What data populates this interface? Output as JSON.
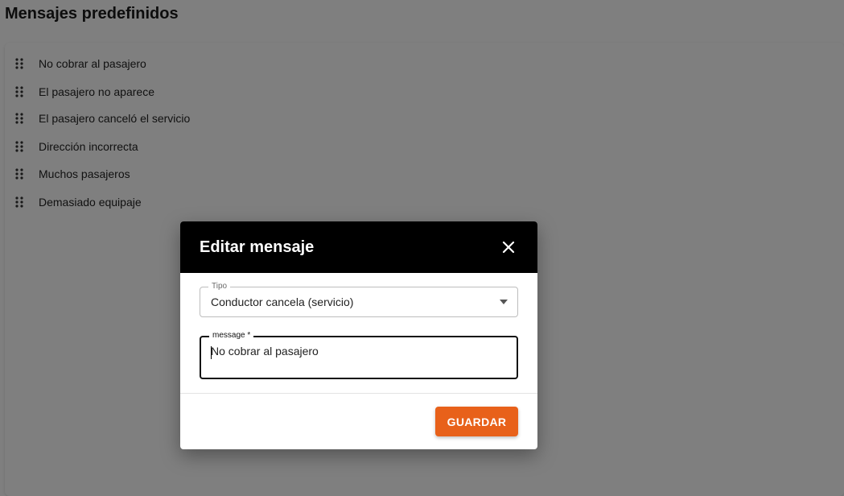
{
  "page": {
    "title": "Mensajes predefinidos"
  },
  "messages": [
    {
      "label": "No cobrar al pasajero"
    },
    {
      "label": "El pasajero no aparece"
    },
    {
      "label": "El pasajero canceló el servicio"
    },
    {
      "label": "Dirección incorrecta"
    },
    {
      "label": "Muchos pasajeros"
    },
    {
      "label": "Demasiado equipaje"
    }
  ],
  "dialog": {
    "title": "Editar mensaje",
    "type_field": {
      "label": "Tipo",
      "value": "Conductor cancela (servicio)"
    },
    "message_field": {
      "label": "message *",
      "value": "No cobrar al pasajero"
    },
    "save_label": "GUARDAR"
  },
  "colors": {
    "accent": "#e8611a",
    "header": "#000000",
    "overlay": "rgba(0,0,0,0.5)"
  },
  "icons": {
    "drag": "drag-handle-icon",
    "close": "close-icon",
    "dropdown": "dropdown-arrow-icon"
  }
}
